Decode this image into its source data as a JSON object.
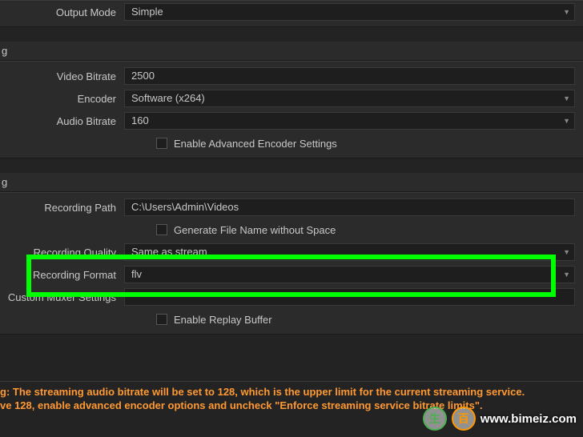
{
  "top": {
    "output_mode": {
      "label": "Output Mode",
      "value": "Simple"
    }
  },
  "streaming": {
    "tab": "g",
    "video_bitrate": {
      "label": "Video Bitrate",
      "value": "2500"
    },
    "encoder": {
      "label": "Encoder",
      "value": "Software (x264)"
    },
    "audio_bitrate": {
      "label": "Audio Bitrate",
      "value": "160"
    },
    "enable_adv": {
      "label": "Enable Advanced Encoder Settings"
    }
  },
  "recording": {
    "tab": "g",
    "path": {
      "label": "Recording Path",
      "value": "C:\\Users\\Admin\\Videos"
    },
    "gen_filename": {
      "label": "Generate File Name without Space"
    },
    "quality": {
      "label": "Recording Quality",
      "value": "Same as stream"
    },
    "format": {
      "label": "Recording Format",
      "value": "flv"
    },
    "muxer": {
      "label": "Custom Muxer Settings",
      "value": ""
    },
    "replay_buffer": {
      "label": "Enable Replay Buffer"
    }
  },
  "warning": {
    "line1": "g: The streaming audio bitrate will be set to 128, which is the upper limit for the current streaming service.",
    "line2": "ve 128, enable advanced encoder options and uncheck \"Enforce streaming service bitrate limits\"."
  },
  "watermark": {
    "zh1": "生",
    "zh2": "百",
    "url": "www.bimeiz.com"
  }
}
